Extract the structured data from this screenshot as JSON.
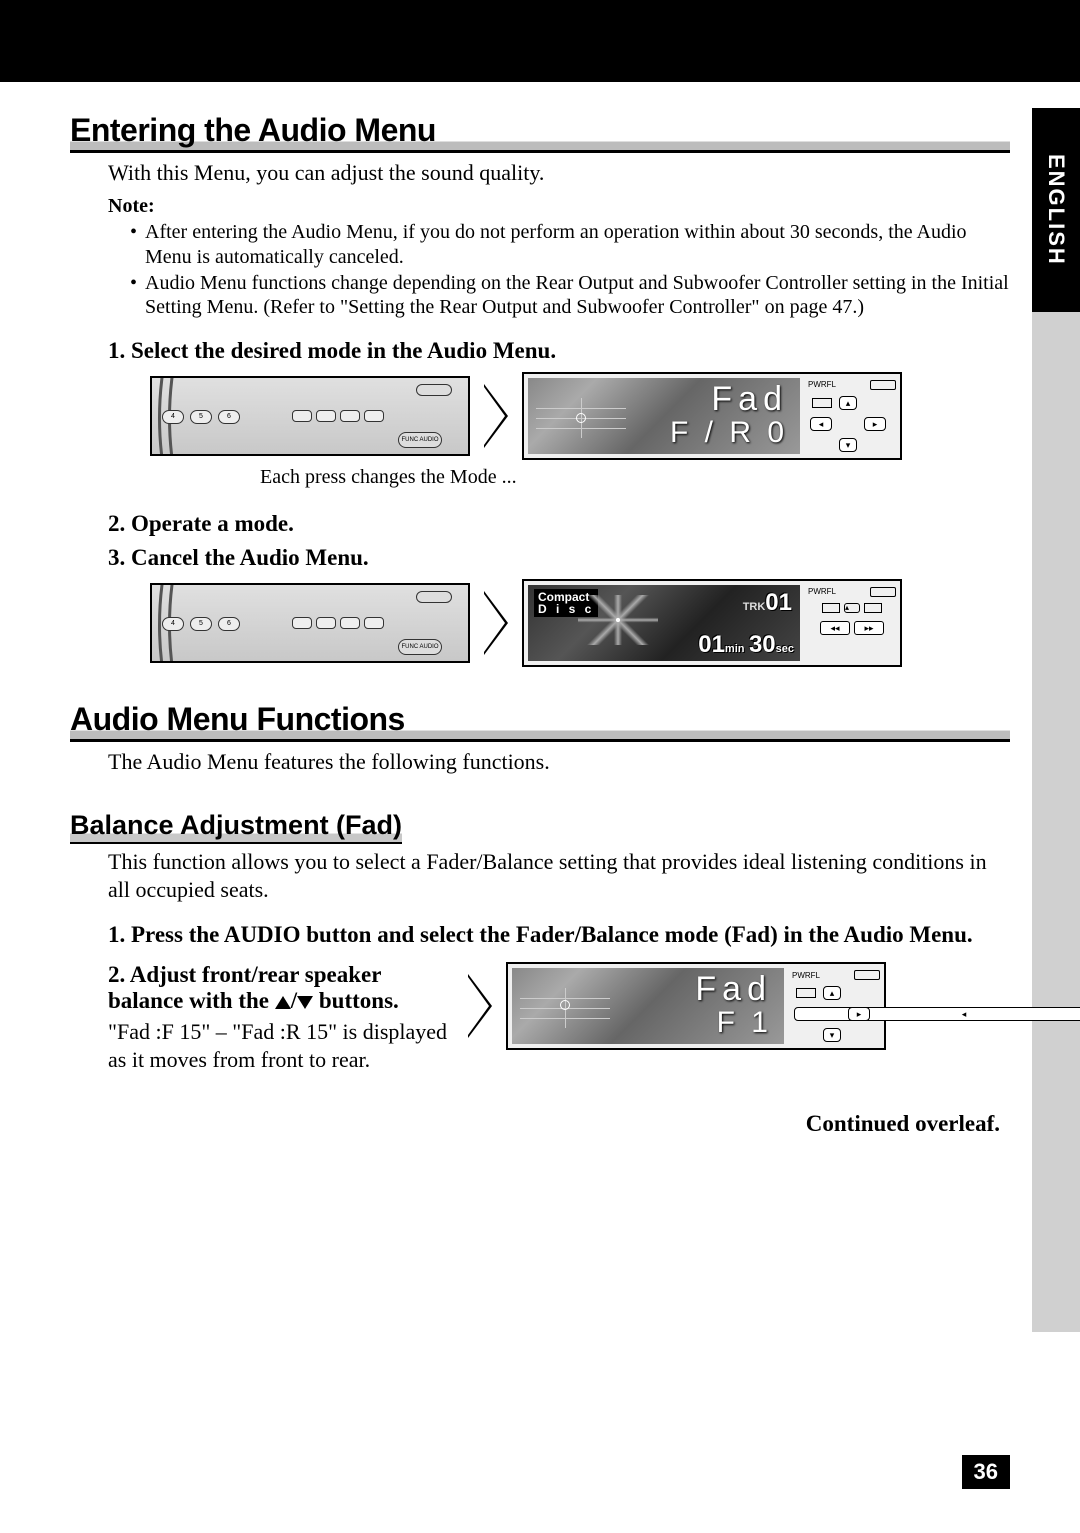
{
  "language_tab": "ENGLISH",
  "section1": {
    "heading": "Entering the Audio Menu",
    "intro": "With this Menu, you can adjust the sound quality.",
    "note_label": "Note:",
    "note_items": [
      "After entering the Audio Menu, if you do not perform an operation within about 30 seconds, the Audio Menu is automatically canceled.",
      "Audio Menu functions change depending on the Rear Output and Subwoofer Controller setting in the Initial Setting Menu. (Refer to \"Setting the Rear Output and Subwoofer Controller\" on page 47.)"
    ],
    "step1": "1.  Select the desired mode in the Audio Menu.",
    "display1_line1": "Fad",
    "display1_line2": "F / R   0",
    "caption1": "Each press changes the Mode ...",
    "step2": "2.  Operate a mode.",
    "step3": "3.  Cancel the Audio Menu.",
    "display2_compact1": "Compact",
    "display2_compact2": "D i s c",
    "display2_trk_label": "TRK",
    "display2_trk_num": "01",
    "display2_time_min": "01",
    "display2_time_min_label": "min",
    "display2_time_sec": "30",
    "display2_time_sec_label": "sec"
  },
  "section2": {
    "heading": "Audio Menu Functions",
    "intro": "The Audio Menu features the following functions.",
    "sub_heading": "Balance Adjustment (Fad)",
    "sub_intro": "This function allows you to select a Fader/Balance setting that provides ideal listening conditions in all occupied seats.",
    "step1": "1.  Press the AUDIO button and select the Fader/Balance mode (Fad) in the Audio Menu.",
    "step2a": "2.  Adjust front/rear speaker balance with the ",
    "step2b": " buttons.",
    "step2_body": "\"Fad :F 15\" – \"Fad :R 15\" is displayed as it moves from front to rear.",
    "display3_line1": "Fad",
    "display3_line2": "F      1",
    "continued": "Continued overleaf."
  },
  "controls": {
    "pwrfl": "PWRFL",
    "func_audio": "FUNC   AUDIO",
    "prev": "◂◂",
    "next": "▸▸",
    "up": "▴",
    "down": "▾",
    "left": "◂",
    "right": "▸"
  },
  "page_number": "36"
}
